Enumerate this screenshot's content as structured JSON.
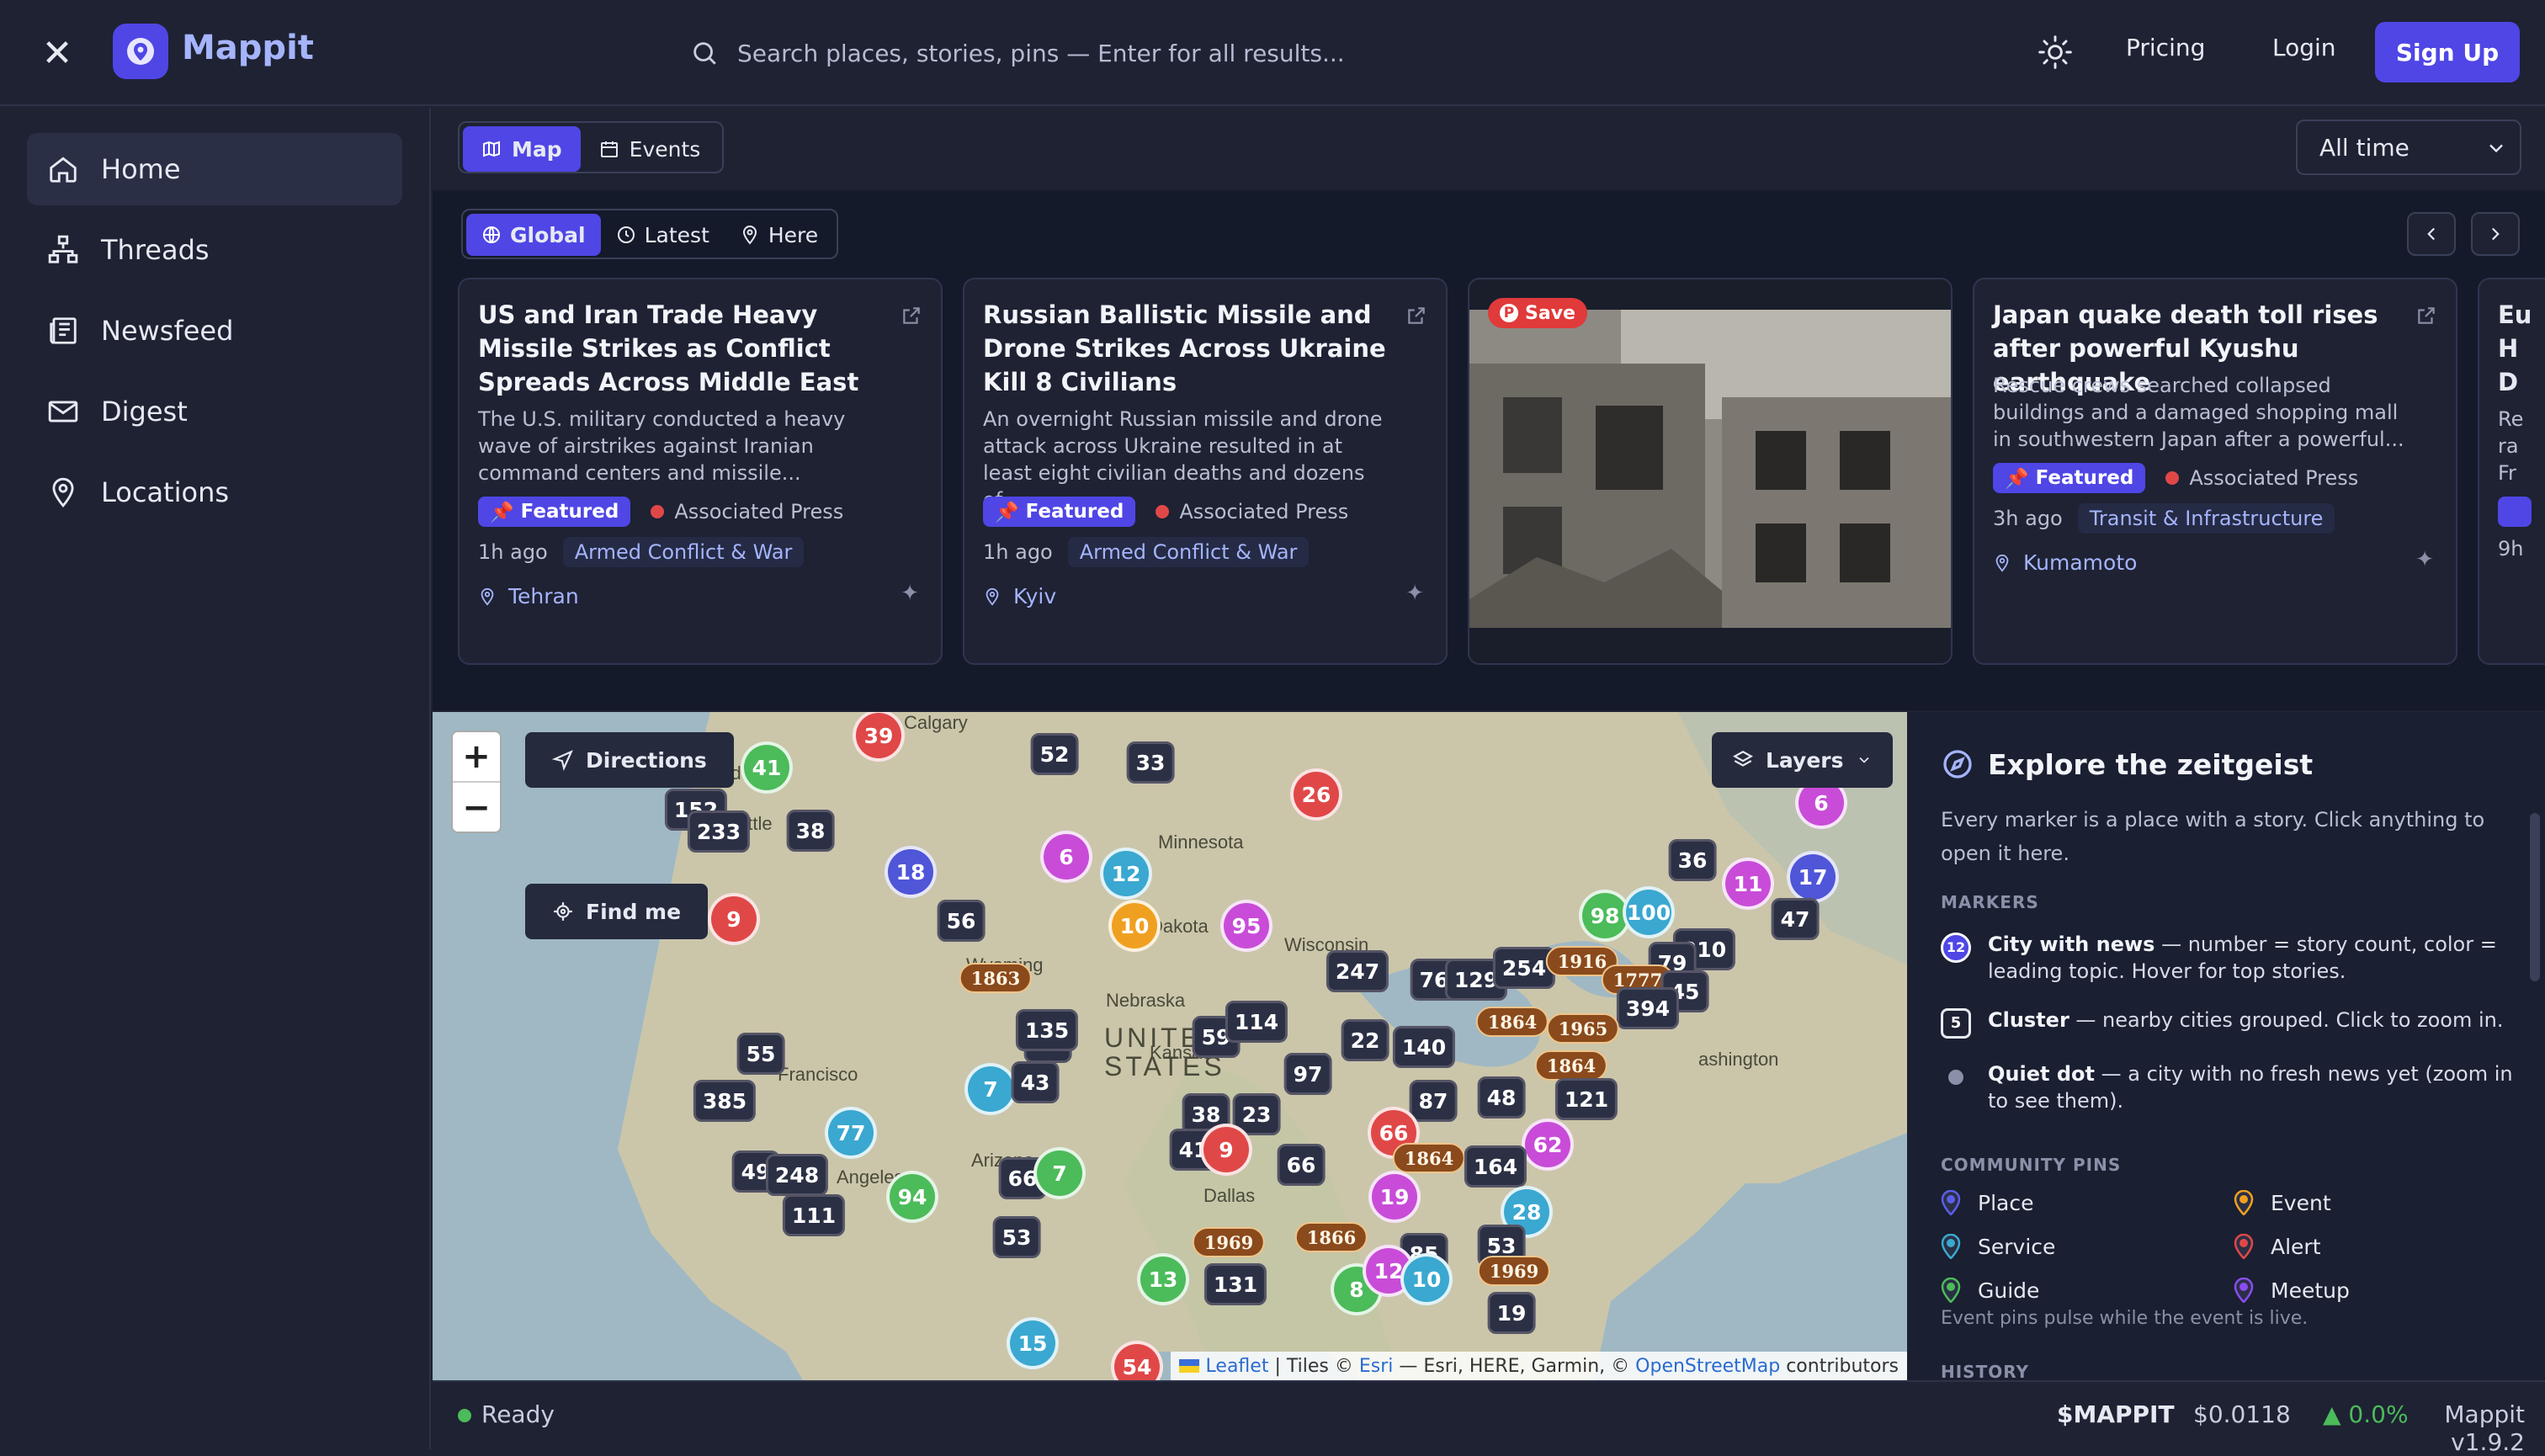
{
  "app": {
    "name": "Mappit"
  },
  "topbar": {
    "search_placeholder": "Search places, stories, pins — Enter for all results...",
    "pricing": "Pricing",
    "login": "Login",
    "signup": "Sign Up"
  },
  "sidebar": {
    "items": [
      {
        "label": "Home",
        "icon": "home-icon",
        "active": true
      },
      {
        "label": "Threads",
        "icon": "threads-icon"
      },
      {
        "label": "Newsfeed",
        "icon": "newsfeed-icon"
      },
      {
        "label": "Digest",
        "icon": "mail-icon"
      },
      {
        "label": "Locations",
        "icon": "location-pin-icon"
      }
    ]
  },
  "view_tabs": [
    {
      "label": "Map",
      "active": true
    },
    {
      "label": "Events"
    }
  ],
  "time_filter": {
    "selected": "All time"
  },
  "scope_tabs": [
    {
      "label": "Global",
      "active": true
    },
    {
      "label": "Latest"
    },
    {
      "label": "Here"
    }
  ],
  "cards": [
    {
      "title": "US and Iran Trade Heavy Missile Strikes as Conflict Spreads Across Middle East",
      "desc": "The U.S. military conducted a heavy wave of airstrikes against Iranian command centers and missile...",
      "featured": "Featured",
      "source": "Associated Press",
      "time": "1h ago",
      "topic": "Armed Conflict & War",
      "location": "Tehran"
    },
    {
      "title": "Russian Ballistic Missile and Drone Strikes Across Ukraine Kill 8 Civilians",
      "desc": "An overnight Russian missile and drone attack across Ukraine resulted in at least eight civilian deaths and dozens of...",
      "featured": "Featured",
      "source": "Associated Press",
      "time": "1h ago",
      "topic": "Armed Conflict & War",
      "location": "Kyiv"
    },
    {
      "image_card": true,
      "save_label": "Save"
    },
    {
      "title": "Japan quake death toll rises after powerful Kyushu earthquake",
      "desc": "Rescue crews searched collapsed buildings and a damaged shopping mall in southwestern Japan after a powerful...",
      "featured": "Featured",
      "source": "Associated Press",
      "time": "3h ago",
      "topic": "Transit & Infrastructure",
      "location": "Kumamoto"
    },
    {
      "partial_title": "Eu\nH\nD",
      "partial_desc": "Re\nra\nFr",
      "partial_time": "9h"
    }
  ],
  "map": {
    "buttons": {
      "directions": "Directions",
      "find_me": "Find me",
      "layers": "Layers"
    },
    "labels": [
      "Calgary",
      "Minnesota",
      "Wisconsin",
      "Dakota",
      "Wyoming",
      "Nebraska",
      "UNITED",
      "STATES",
      "Kansas",
      "Dallas",
      "Francisco",
      "Angeles",
      "Arizona",
      "ashington",
      "attle",
      "and"
    ],
    "attribution": {
      "leaflet": "Leaflet",
      "tiles": "| Tiles ©",
      "esri": "Esri",
      "rest": "— Esri, HERE, Garmin, ©",
      "osm": "OpenStreetMap",
      "contrib": "contributors"
    },
    "markers": [
      {
        "t": "39",
        "k": "c",
        "col": "#e04848"
      },
      {
        "t": "41",
        "k": "c",
        "col": "#4cbb5a"
      },
      {
        "t": "52",
        "k": "sq"
      },
      {
        "t": "33",
        "k": "sq"
      },
      {
        "t": "26",
        "k": "c",
        "col": "#e04848"
      },
      {
        "t": "152",
        "k": "sq"
      },
      {
        "t": "233",
        "k": "sq"
      },
      {
        "t": "38",
        "k": "sq"
      },
      {
        "t": "18",
        "k": "c",
        "col": "#4f56d8"
      },
      {
        "t": "6",
        "k": "c",
        "col": "#c84cd8"
      },
      {
        "t": "12",
        "k": "c",
        "col": "#3aa8d0"
      },
      {
        "t": "9",
        "k": "c",
        "col": "#e04848"
      },
      {
        "t": "56",
        "k": "sq"
      },
      {
        "t": "1863",
        "k": "yr"
      },
      {
        "t": "10",
        "k": "c",
        "col": "#f0a020"
      },
      {
        "t": "95",
        "k": "c",
        "col": "#c84cd8"
      },
      {
        "t": "85",
        "k": "sq"
      },
      {
        "t": "247",
        "k": "sq"
      },
      {
        "t": "76",
        "k": "sq"
      },
      {
        "t": "129",
        "k": "sq"
      },
      {
        "t": "254",
        "k": "sq"
      },
      {
        "t": "1916",
        "k": "yr"
      },
      {
        "t": "98",
        "k": "c",
        "col": "#4cbb5a"
      },
      {
        "t": "100",
        "k": "c",
        "col": "#3aa8d0"
      },
      {
        "t": "36",
        "k": "sq"
      },
      {
        "t": "11",
        "k": "c",
        "col": "#c84cd8"
      },
      {
        "t": "17",
        "k": "c",
        "col": "#4f56d8"
      },
      {
        "t": "47",
        "k": "sq"
      },
      {
        "t": "210",
        "k": "sq"
      },
      {
        "t": "79",
        "k": "sq"
      },
      {
        "t": "1777",
        "k": "yr"
      },
      {
        "t": "45",
        "k": "sq"
      },
      {
        "t": "394",
        "k": "sq"
      },
      {
        "t": "135",
        "k": "sq"
      },
      {
        "t": "59",
        "k": "sq"
      },
      {
        "t": "114",
        "k": "sq"
      },
      {
        "t": "22",
        "k": "sq"
      },
      {
        "t": "140",
        "k": "sq"
      },
      {
        "t": "1864",
        "k": "yr"
      },
      {
        "t": "1965",
        "k": "yr"
      },
      {
        "t": "1864",
        "k": "yr"
      },
      {
        "t": "55",
        "k": "sq"
      },
      {
        "t": "7",
        "k": "c",
        "col": "#3aa8d0"
      },
      {
        "t": "43",
        "k": "sq"
      },
      {
        "t": "97",
        "k": "sq"
      },
      {
        "t": "87",
        "k": "sq"
      },
      {
        "t": "48",
        "k": "sq"
      },
      {
        "t": "121",
        "k": "sq"
      },
      {
        "t": "385",
        "k": "sq"
      },
      {
        "t": "77",
        "k": "c",
        "col": "#3aa8d0"
      },
      {
        "t": "38",
        "k": "sq"
      },
      {
        "t": "23",
        "k": "sq"
      },
      {
        "t": "66",
        "k": "c",
        "col": "#e04848"
      },
      {
        "t": "62",
        "k": "c",
        "col": "#c84cd8"
      },
      {
        "t": "41",
        "k": "sq"
      },
      {
        "t": "9",
        "k": "c",
        "col": "#e04848"
      },
      {
        "t": "66",
        "k": "sq"
      },
      {
        "t": "1864",
        "k": "yr"
      },
      {
        "t": "164",
        "k": "sq"
      },
      {
        "t": "49",
        "k": "sq"
      },
      {
        "t": "248",
        "k": "sq"
      },
      {
        "t": "66",
        "k": "sq"
      },
      {
        "t": "7",
        "k": "c",
        "col": "#4cbb5a"
      },
      {
        "t": "19",
        "k": "c",
        "col": "#c84cd8"
      },
      {
        "t": "28",
        "k": "c",
        "col": "#3aa8d0"
      },
      {
        "t": "111",
        "k": "sq"
      },
      {
        "t": "94",
        "k": "c",
        "col": "#4cbb5a"
      },
      {
        "t": "53",
        "k": "sq"
      },
      {
        "t": "1969",
        "k": "yr"
      },
      {
        "t": "1866",
        "k": "yr"
      },
      {
        "t": "85",
        "k": "sq"
      },
      {
        "t": "53",
        "k": "sq"
      },
      {
        "t": "13",
        "k": "c",
        "col": "#4cbb5a"
      },
      {
        "t": "131",
        "k": "sq"
      },
      {
        "t": "8",
        "k": "c",
        "col": "#4cbb5a"
      },
      {
        "t": "12",
        "k": "c",
        "col": "#c84cd8"
      },
      {
        "t": "10",
        "k": "c",
        "col": "#3aa8d0"
      },
      {
        "t": "1969",
        "k": "yr"
      },
      {
        "t": "19",
        "k": "sq"
      },
      {
        "t": "15",
        "k": "c",
        "col": "#3aa8d0"
      },
      {
        "t": "54",
        "k": "c",
        "col": "#e04848"
      },
      {
        "t": "6",
        "k": "c",
        "col": "#c84cd8"
      }
    ]
  },
  "explore": {
    "title": "Explore the zeitgeist",
    "desc": "Every marker is a place with a story. Click anything to open it here.",
    "markers_label": "MARKERS",
    "marker_rows": [
      {
        "icon_text": "12",
        "name": "City with news",
        "desc": " — number = story count, color = leading topic. Hover for top stories."
      },
      {
        "icon_text": "5",
        "name": "Cluster",
        "desc": " — nearby cities grouped. Click to zoom in."
      },
      {
        "icon_text": "",
        "name": "Quiet dot",
        "desc": " — a city with no fresh news yet (zoom in to see them)."
      }
    ],
    "community_label": "COMMUNITY PINS",
    "pins": [
      {
        "label": "Place",
        "color": "#5b5ee8"
      },
      {
        "label": "Event",
        "color": "#f0a020"
      },
      {
        "label": "Service",
        "color": "#3aa8d0"
      },
      {
        "label": "Alert",
        "color": "#e04848"
      },
      {
        "label": "Guide",
        "color": "#4cbb5a"
      },
      {
        "label": "Meetup",
        "color": "#8a4cf0"
      }
    ],
    "pulse_note": "Event pins pulse while the event is live.",
    "history_label": "HISTORY"
  },
  "footer": {
    "status": "Ready",
    "ticker": "$MAPPIT",
    "price": "$0.0118",
    "change": "▲ 0.0%",
    "version": "Mappit v1.9.2"
  }
}
